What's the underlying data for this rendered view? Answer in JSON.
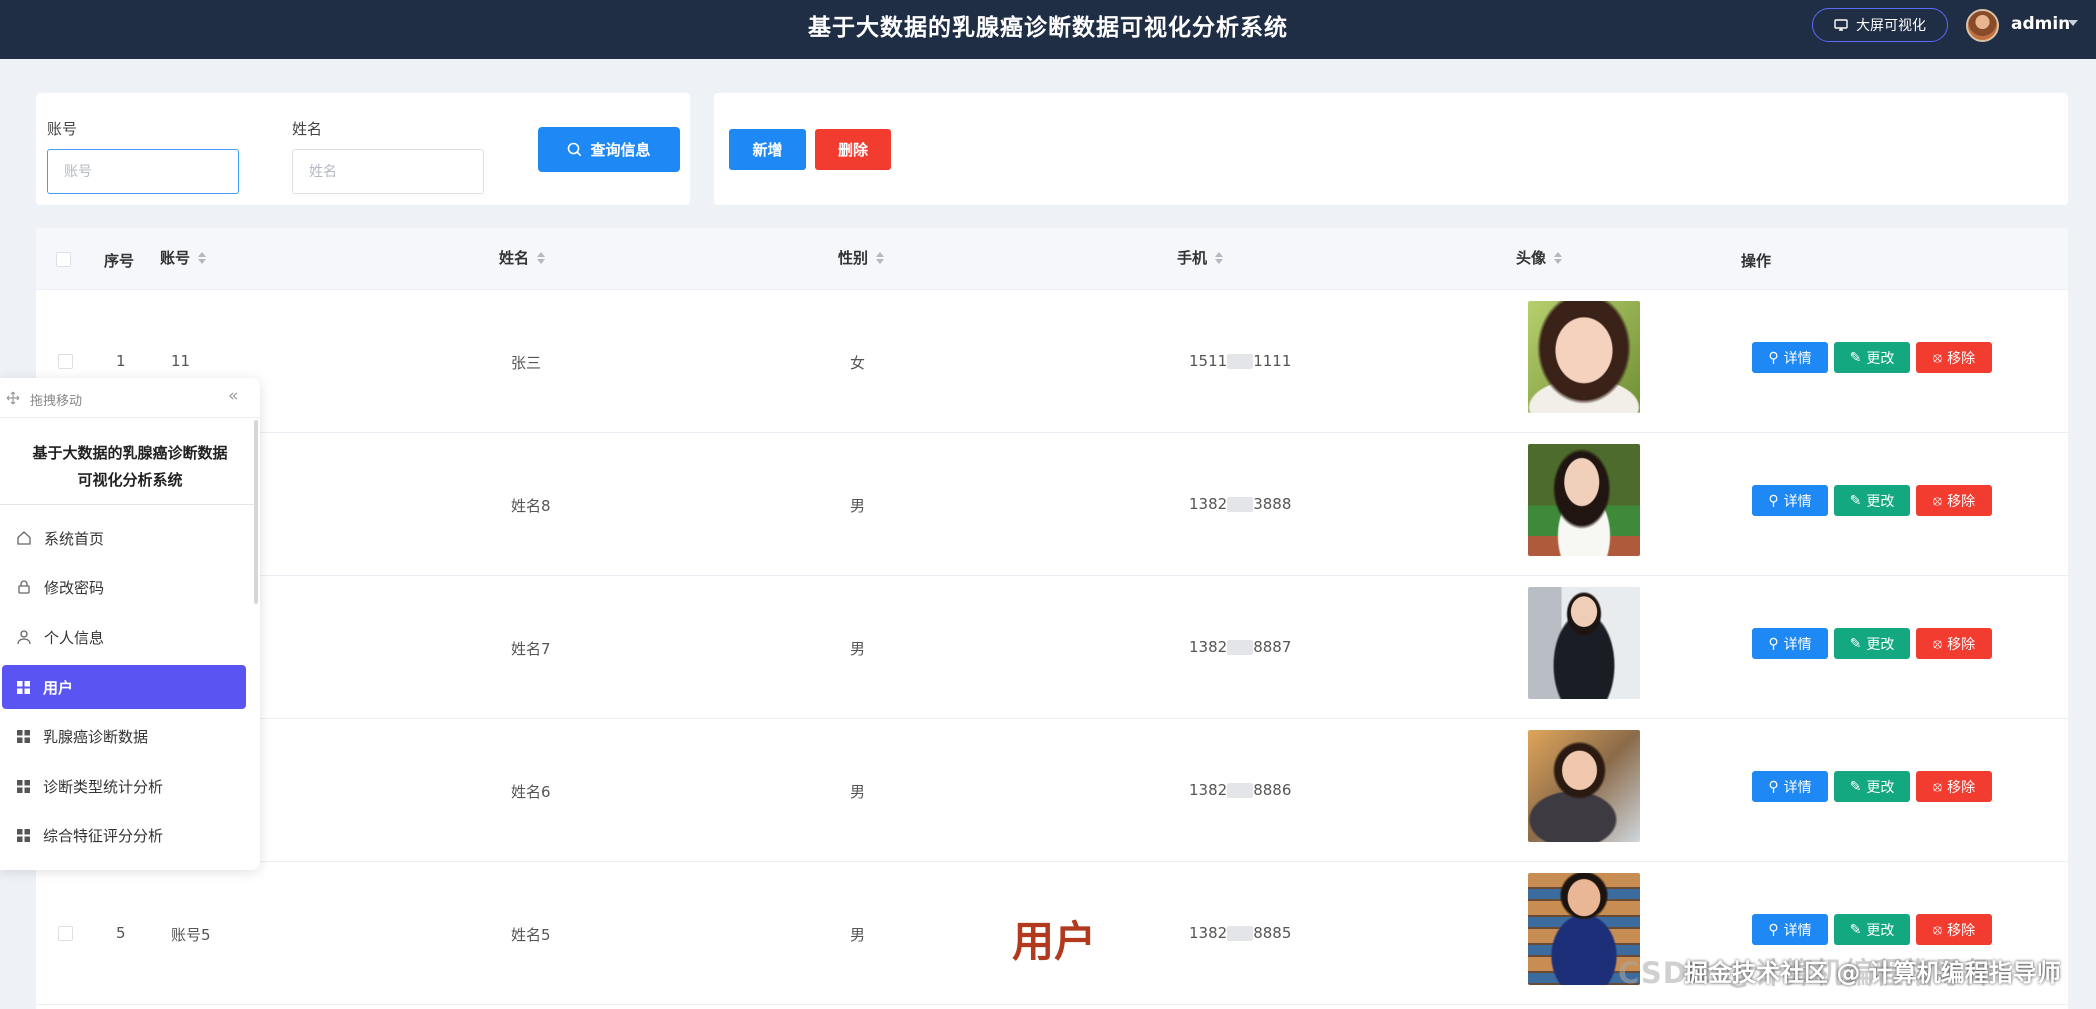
{
  "header": {
    "title": "基于大数据的乳腺癌诊断数据可视化分析系统",
    "bigscreen_label": "大屏可视化",
    "username": "admin"
  },
  "search": {
    "account_label": "账号",
    "account_placeholder": "账号",
    "name_label": "姓名",
    "name_placeholder": "姓名",
    "query_label": "查询信息"
  },
  "actions": {
    "add_label": "新增",
    "delete_label": "删除"
  },
  "table": {
    "columns": [
      "序号",
      "账号",
      "姓名",
      "性别",
      "手机",
      "头像",
      "操作"
    ],
    "rows": [
      {
        "index": "1",
        "account": "11",
        "name": "张三",
        "gender": "女",
        "phone_start": "1511",
        "phone_end": "1111"
      },
      {
        "index": "",
        "account": "",
        "name": "姓名8",
        "gender": "男",
        "phone_start": "1382",
        "phone_end": "3888"
      },
      {
        "index": "",
        "account": "",
        "name": "姓名7",
        "gender": "男",
        "phone_start": "1382",
        "phone_end": "8887"
      },
      {
        "index": "",
        "account": "",
        "name": "姓名6",
        "gender": "男",
        "phone_start": "1382",
        "phone_end": "8886"
      },
      {
        "index": "5",
        "account": "账号5",
        "name": "姓名5",
        "gender": "男",
        "phone_start": "1382",
        "phone_end": "8885"
      }
    ],
    "detail_label": "详情",
    "edit_label": "更改",
    "remove_label": "移除"
  },
  "sidemenu": {
    "drag_label": "拖拽移动",
    "title_line1": "基于大数据的乳腺癌诊断数据",
    "title_line2": "可视化分析系统",
    "items": [
      {
        "label": "系统首页",
        "icon": "home-icon"
      },
      {
        "label": "修改密码",
        "icon": "lock-icon"
      },
      {
        "label": "个人信息",
        "icon": "user-icon"
      },
      {
        "label": "用户",
        "icon": "grid-icon",
        "active": true
      },
      {
        "label": "乳腺癌诊断数据",
        "icon": "grid-icon"
      },
      {
        "label": "诊断类型统计分析",
        "icon": "grid-icon"
      },
      {
        "label": "综合特征评分分析",
        "icon": "grid-icon"
      }
    ]
  },
  "overlay": {
    "caption": "用户",
    "watermark_back": "CSDN @计算机编程指导师",
    "watermark_front": "掘金技术社区 @ 计算机编程指导师"
  },
  "colors": {
    "header_bg": "#1f2d45",
    "primary": "#1e88f5",
    "danger": "#f23c2f",
    "success": "#13a880",
    "menu_active": "#5a55f2"
  }
}
